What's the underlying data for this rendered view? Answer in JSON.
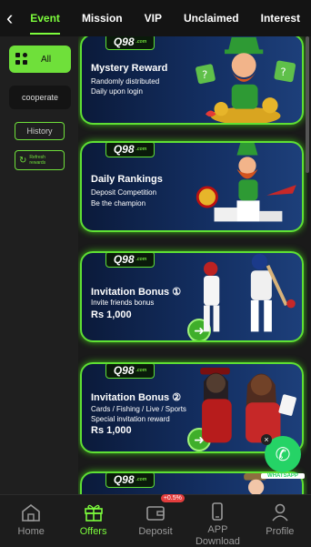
{
  "header": {
    "back_icon": "chevron-left-icon",
    "tabs": [
      {
        "label": "Event",
        "active": true
      },
      {
        "label": "Mission",
        "active": false
      },
      {
        "label": "VIP",
        "active": false
      },
      {
        "label": "Unclaimed",
        "active": false
      },
      {
        "label": "Interest",
        "active": false
      }
    ]
  },
  "sidebar": {
    "all_label": "All",
    "cooperate_label": "cooperate",
    "history_label": "History",
    "refresh_label": "Refresh rewards"
  },
  "banners": [
    {
      "logo": "Q98",
      "logo_sub": ".com",
      "title": "Mystery Reward",
      "lines": [
        "Randomly distributed",
        "Daily upon login"
      ],
      "amount": ""
    },
    {
      "logo": "Q98",
      "logo_sub": ".com",
      "title": "Daily Rankings",
      "lines": [
        "Deposit Competition",
        "Be the champion"
      ],
      "amount": ""
    },
    {
      "logo": "Q98",
      "logo_sub": ".com",
      "title": "Invitation Bonus ①",
      "lines": [
        "Invite friends bonus"
      ],
      "amount": "Rs 1,000"
    },
    {
      "logo": "Q98",
      "logo_sub": ".com",
      "title": "Invitation Bonus ②",
      "lines": [
        "Cards / Fishing / Live / Sports",
        "Special invitation reward"
      ],
      "amount": "Rs 1,000"
    },
    {
      "logo": "Q98",
      "logo_sub": ".com",
      "title": "",
      "lines": [],
      "amount": ""
    }
  ],
  "whatsapp": {
    "label": "WHATSAPP",
    "close": "×"
  },
  "bottom_nav": [
    {
      "label": "Home",
      "icon": "home-icon",
      "active": false
    },
    {
      "label": "Offers",
      "icon": "gift-icon",
      "active": true
    },
    {
      "label": "Deposit",
      "icon": "wallet-icon",
      "active": false,
      "badge": "+0.5%"
    },
    {
      "label": "APP Download",
      "icon": "phone-icon",
      "active": false
    },
    {
      "label": "Profile",
      "icon": "user-icon",
      "active": false
    }
  ],
  "colors": {
    "accent": "#7cfc3c",
    "banner_bg": "#143064",
    "badge": "#e33d3d"
  }
}
